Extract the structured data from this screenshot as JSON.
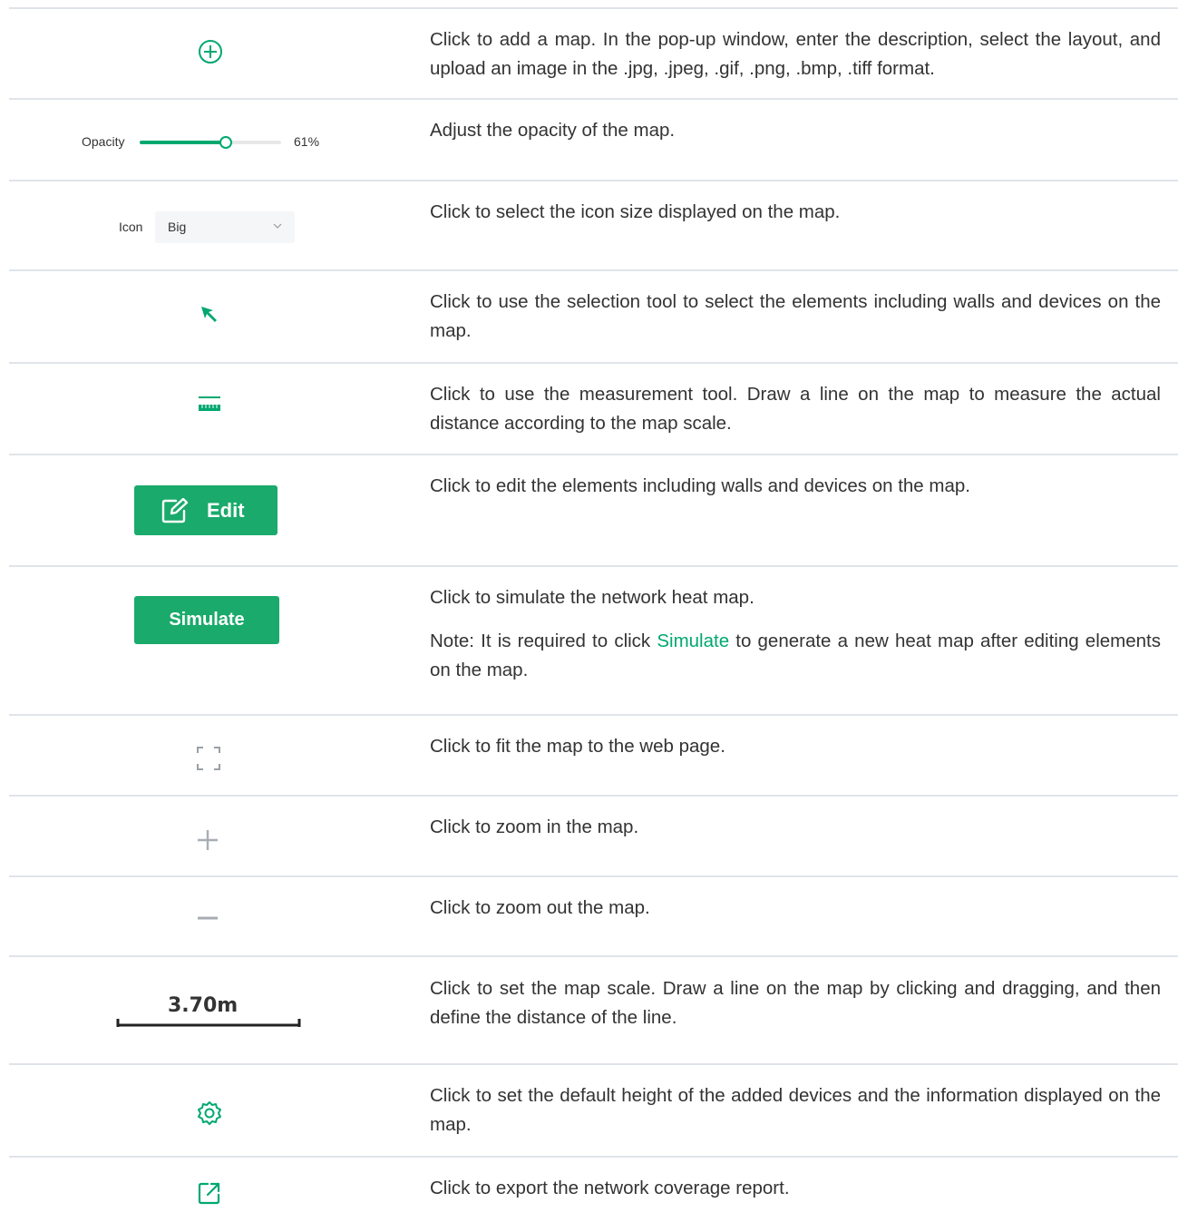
{
  "colors": {
    "accent": "#00a870",
    "button": "#1aaa6b",
    "rule": "#dfe4ea",
    "text": "#333333"
  },
  "rows": [
    {
      "icon": "add-circle-icon",
      "desc": "Click to add a map. In the pop-up window, enter the description, select the layout, and upload an image in the .jpg, .jpeg, .gif, .png, .bmp, .tiff format."
    },
    {
      "icon": "opacity-slider",
      "desc": "Adjust the opacity of the map."
    },
    {
      "icon": "icon-size-select",
      "desc": "Click to select the icon size displayed on the map."
    },
    {
      "icon": "selection-arrow-icon",
      "desc": "Click to use the selection tool to select the elements including walls and devices on the map."
    },
    {
      "icon": "ruler-icon",
      "desc": "Click to use the measurement tool. Draw a line on the map to measure the actual distance according to the map scale."
    },
    {
      "icon": "edit-button",
      "desc": "Click to edit the elements including walls and devices on the map."
    },
    {
      "icon": "simulate-button",
      "desc": "Click to simulate the network heat map.",
      "note_before": "Note: It is required to click ",
      "note_link": "Simulate",
      "note_after": " to generate a new heat map after editing elements on the map."
    },
    {
      "icon": "fit-screen-icon",
      "desc": "Click to fit the map to the web page."
    },
    {
      "icon": "zoom-in-icon",
      "desc": "Click to zoom in the map."
    },
    {
      "icon": "zoom-out-icon",
      "desc": "Click to zoom out the map."
    },
    {
      "icon": "map-scale",
      "desc": "Click to set the map scale. Draw a line on the map by clicking and dragging, and then define the distance of the line."
    },
    {
      "icon": "gear-icon",
      "desc": "Click to set the default height of the added devices and the information displayed on the map."
    },
    {
      "icon": "export-icon",
      "desc": "Click to export the network coverage report."
    }
  ],
  "opacity": {
    "label": "Opacity",
    "value": 0.61,
    "value_text": "61%"
  },
  "icon_size": {
    "label": "Icon",
    "selected": "Big"
  },
  "edit_button": {
    "label": "Edit"
  },
  "simulate_button": {
    "label": "Simulate"
  },
  "map_scale": {
    "text": "3.70m"
  }
}
